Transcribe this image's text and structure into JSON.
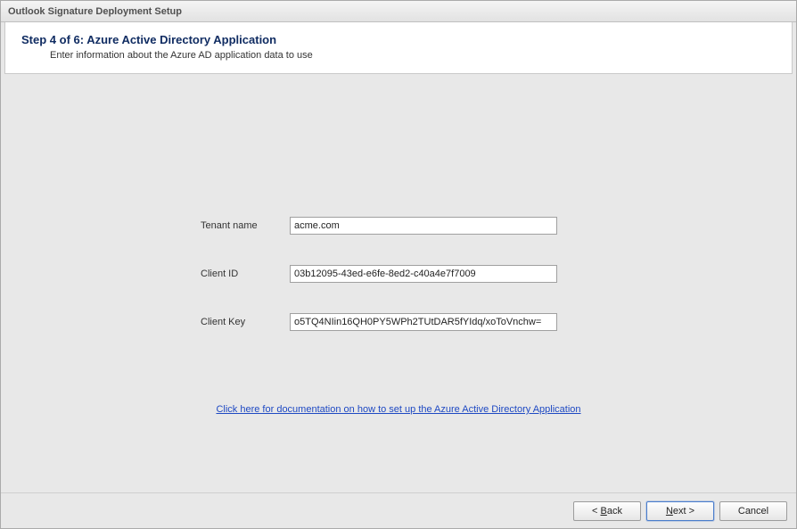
{
  "window_title": "Outlook Signature Deployment Setup",
  "header": {
    "title": "Step 4 of 6: Azure Active Directory Application",
    "description": "Enter information about the Azure AD application data to use"
  },
  "form": {
    "tenant_label": "Tenant name",
    "tenant_value": "acme.com",
    "client_id_label": "Client ID",
    "client_id_value": "03b12095-43ed-e6fe-8ed2-c40a4e7f7009",
    "client_key_label": "Client Key",
    "client_key_value": "o5TQ4NIin16QH0PY5WPh2TUtDAR5fYIdq/xoToVnchw="
  },
  "doc_link_text": "Click here for documentation on how to set up the Azure Active Directory Application",
  "buttons": {
    "back_prefix": "< ",
    "back_mnemonic": "B",
    "back_suffix": "ack",
    "next_mnemonic": "N",
    "next_suffix": "ext >",
    "cancel": "Cancel"
  }
}
